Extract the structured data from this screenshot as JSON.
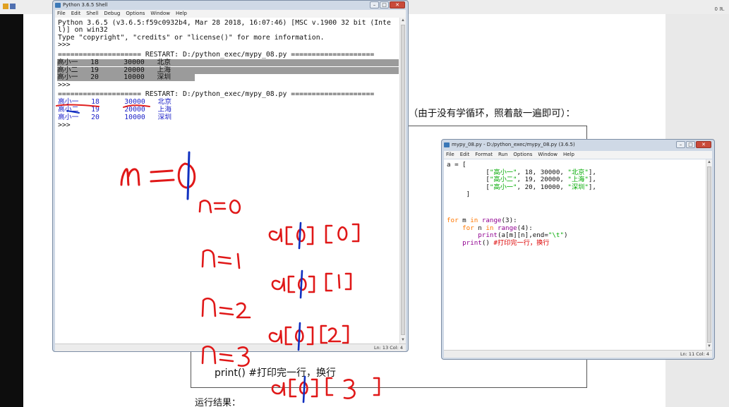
{
  "document": {
    "heading": "）（由于没有学循环，照着敲一遍即可）：",
    "code_print": "print() #打印完一行，换行",
    "result_label": "运行结果："
  },
  "topbar": {
    "right_text": "0 ℝ."
  },
  "shell": {
    "title": "Python 3.6.5 Shell",
    "menu": [
      "File",
      "Edit",
      "Shell",
      "Debug",
      "Options",
      "Window",
      "Help"
    ],
    "lines": [
      "Python 3.6.5 (v3.6.5:f59c0932b4, Mar 28 2018, 16:07:46) [MSC v.1900 32 bit (Inte",
      "l)] on win32",
      "Type \"copyright\", \"credits\" or \"license()\" for more information.",
      ">>> ",
      "==================== RESTART: D:/python_exec/mypy_08.py ====================",
      "高小一   18      30000   北京",
      "高小二   19      20000   上海",
      "高小一   20      10000   深圳",
      ">>> ",
      "==================== RESTART: D:/python_exec/mypy_08.py ====================",
      "高小一   18      30000   北京",
      "高小二   19      20000   上海",
      "高小一   20      10000   深圳",
      ">>> "
    ],
    "status": "Ln: 13  Col: 4"
  },
  "editor": {
    "title": "mypy_08.py - D:/python_exec/mypy_08.py (3.6.5)",
    "menu": [
      "File",
      "Edit",
      "Format",
      "Run",
      "Options",
      "Window",
      "Help"
    ],
    "status": "Ln: 11  Col: 4",
    "code": {
      "l1": "a = [",
      "l2_a": "          [",
      "l2_s1": "\"高小一\"",
      "l2_m": ", 18, 30000, ",
      "l2_s2": "\"北京\"",
      "l2_e": "],",
      "l3_a": "          [",
      "l3_s1": "\"高小二\"",
      "l3_m": ", 19, 20000, ",
      "l3_s2": "\"上海\"",
      "l3_e": "],",
      "l4_a": "          [",
      "l4_s1": "\"高小一\"",
      "l4_m": ", 20, 10000, ",
      "l4_s2": "\"深圳\"",
      "l4_e": "],",
      "l5": "     ]",
      "for1": "for",
      "for1_m": " m ",
      "in1": "in",
      "range1": "range",
      "for1_e": "(3):",
      "for2_a": "    ",
      "for2": "for",
      "for2_m": " n ",
      "in2": "in",
      "range2": "range",
      "for2_e": "(4):",
      "pr_a": "        ",
      "pr": "print",
      "pr_m": "(a[m][n],end=",
      "pr_s": "\"\\t\"",
      "pr_e": ")",
      "pr2_a": "    ",
      "pr2": "print",
      "pr2_m": "() ",
      "pr2_c": "#打印完一行，换行"
    }
  },
  "annotations": {
    "m_eq": "m=0",
    "n0": "n=0",
    "n1": "n=1",
    "n2": "n=2",
    "n3": "n=3",
    "a0": "a[0][0]",
    "a1": "a[0][1]",
    "a2": "a[0][2]",
    "a3": "a[0][3]"
  }
}
